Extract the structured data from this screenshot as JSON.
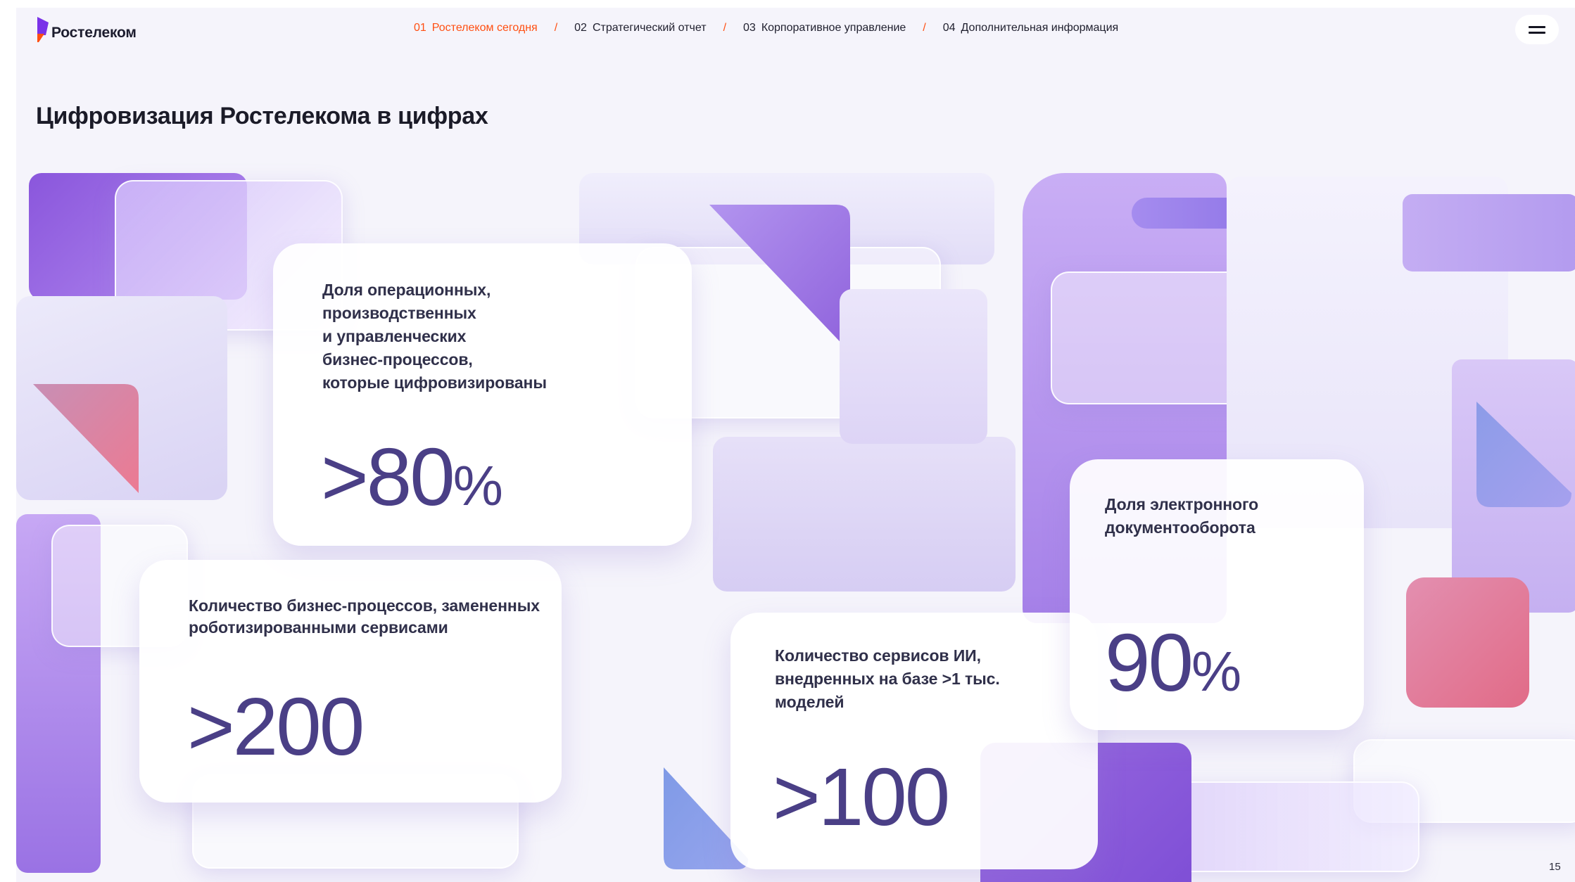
{
  "header": {
    "logo_text": "Ростелеком",
    "nav": [
      {
        "num": "01",
        "label": "Ростелеком сегодня",
        "active": true
      },
      {
        "num": "02",
        "label": "Стратегический отчет",
        "active": false
      },
      {
        "num": "03",
        "label": "Корпоративное управление",
        "active": false
      },
      {
        "num": "04",
        "label": "Дополнительная информация",
        "active": false
      }
    ],
    "nav_separator": "/",
    "menu_icon": "hamburger-icon"
  },
  "page_title": "Цифровизация Ростелекома в цифрах",
  "cards": {
    "processes": {
      "label": "Доля операционных,\nпроизводственных\nи управленческих\nбизнес-процессов,\nкоторые цифровизированы",
      "value": ">80",
      "unit": "%"
    },
    "robotized": {
      "label": "Количество бизнес-процессов, замененных\nроботизированными сервисами",
      "value": ">200",
      "unit": ""
    },
    "ai_services": {
      "label": "Количество сервисов ИИ,\nвнедренных на базе >1 тыс.\nмоделей",
      "value": ">100",
      "unit": ""
    },
    "edo": {
      "label": "Доля электронного\nдокументооборота",
      "value": "90",
      "unit": "%"
    }
  },
  "page_number": "15",
  "colors": {
    "accent_orange": "#ff4f12",
    "value_purple": "#4a3f86",
    "shape_purple": "#9a6be0",
    "shape_pink": "#e07b9c",
    "shape_blue": "#8f9ae6",
    "background": "#f5f4fb"
  }
}
